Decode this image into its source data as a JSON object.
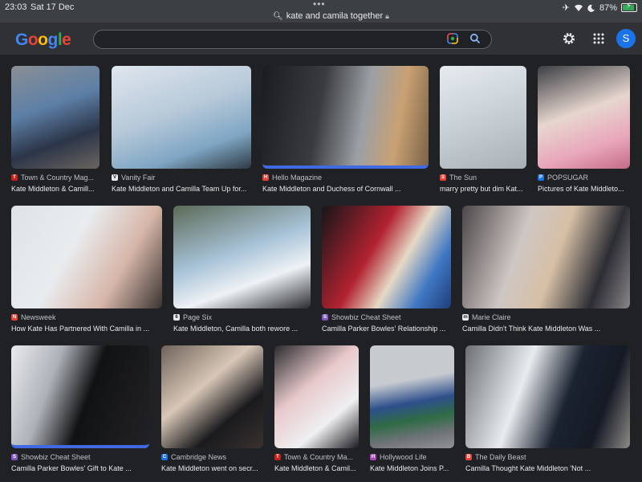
{
  "status_bar": {
    "time": "23:03",
    "date": "Sat 17 Dec",
    "url": "kate and camila together",
    "battery": "87%",
    "battery_level": 0.87
  },
  "header": {
    "logo": [
      "G",
      "o",
      "o",
      "g",
      "l",
      "e"
    ],
    "search_value": "",
    "avatar_initial": "S"
  },
  "results": [
    {
      "source": "Town & Country Mag...",
      "title": "Kate Middleton & Camill...",
      "fav_color": "#c5221f",
      "fav_char": "T"
    },
    {
      "source": "Vanity Fair",
      "title": "Kate Middleton and Camilla Team Up for...",
      "fav_color": "#e8eaed",
      "fav_char": "V"
    },
    {
      "source": "Hello Magazine",
      "title": "Kate Middleton and Duchess of Cornwall ...",
      "fav_color": "#ea4335",
      "fav_char": "H"
    },
    {
      "source": "The Sun",
      "title": "marry pretty but dim Kat...",
      "fav_color": "#ea4335",
      "fav_char": "S"
    },
    {
      "source": "POPSUGAR",
      "title": "Pictures of Kate Middleto...",
      "fav_color": "#1a73e8",
      "fav_char": "P"
    },
    {
      "source": "Newsweek",
      "title": "How Kate Has Partnered With Camilla in ...",
      "fav_color": "#ea4335",
      "fav_char": "N"
    },
    {
      "source": "Page Six",
      "title": "Kate Middleton, Camilla both rewore ...",
      "fav_color": "#e8eaed",
      "fav_char": "6"
    },
    {
      "source": "Showbiz Cheat Sheet",
      "title": "Camilla Parker Bowles' Relationship ...",
      "fav_color": "#7e57c2",
      "fav_char": "S"
    },
    {
      "source": "Marie Claire",
      "title": "Camilla Didn't Think Kate Middleton Was ...",
      "fav_color": "#e8eaed",
      "fav_char": "m"
    },
    {
      "source": "Showbiz Cheat Sheet",
      "title": "Camilla Parker Bowles' Gift to Kate ...",
      "fav_color": "#7e57c2",
      "fav_char": "S"
    },
    {
      "source": "Cambridge News",
      "title": "Kate Middleton went on secr...",
      "fav_color": "#1a73e8",
      "fav_char": "C"
    },
    {
      "source": "Town & Country Ma...",
      "title": "Kate Middleton & Camil...",
      "fav_color": "#c5221f",
      "fav_char": "T"
    },
    {
      "source": "Hollywood Life",
      "title": "Kate Middleton Joins P...",
      "fav_color": "#ab47bc",
      "fav_char": "H"
    },
    {
      "source": "The Daily Beast",
      "title": "Camilla Thought Kate Middleton 'Not ...",
      "fav_color": "#ea4335",
      "fav_char": "B"
    }
  ],
  "colors": {
    "background": "#202124",
    "header": "#303134",
    "selected_bar": "#4169e1"
  }
}
